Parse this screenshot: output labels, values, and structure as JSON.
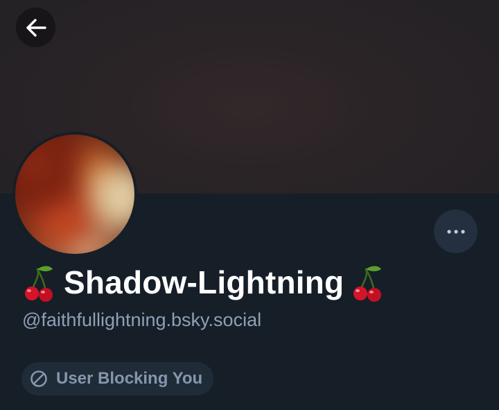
{
  "header": {
    "back_icon": "arrow-left-icon",
    "banner_color": "#2b2427"
  },
  "profile": {
    "display_name": "Shadow-Lightning",
    "name_prefix_emoji": "cherries-emoji",
    "name_suffix_emoji": "cherries-emoji",
    "handle": "@faithfullightning.bsky.social",
    "avatar": "blurred-avatar-image",
    "more_icon": "ellipsis-icon"
  },
  "status": {
    "icon": "block-icon",
    "label": "User Blocking You"
  },
  "colors": {
    "background": "#161e27",
    "name": "#ffffff",
    "handle": "#8ea0b8",
    "pill_background": "#202b38",
    "pill_text": "#8497ad"
  }
}
